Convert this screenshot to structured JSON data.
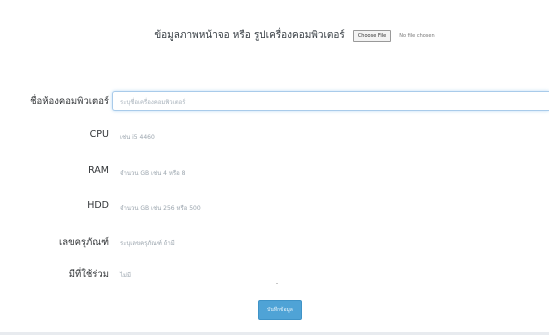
{
  "upload": {
    "label": "ข้อมูลภาพหน้าจอ หรือ รูปเครื่องคอมพิวเตอร์",
    "button_label": "Choose File",
    "status_text": "No file chosen"
  },
  "form": {
    "computer_name": {
      "label": "ชื่อห้องคอมพิวเตอร์",
      "placeholder": "ระบุชื่อเครื่องคอมพิวเตอร์"
    },
    "cpu": {
      "label": "CPU",
      "value": "เช่น i5 4460"
    },
    "ram": {
      "label": "RAM",
      "value": "จำนวน GB เช่น 4 หรือ 8"
    },
    "hdd": {
      "label": "HDD",
      "value": "จำนวน GB เช่น 256 หรือ 500"
    },
    "asset_number": {
      "label": "เลขครุภัณฑ์",
      "value": "ระบุเลขครุภัณฑ์ ถ้ามี"
    },
    "printer": {
      "label": "มีที่ใช้ร่วม",
      "value": "ไม่มี"
    }
  },
  "submit": {
    "label": "บันทึกข้อมูล"
  },
  "colors": {
    "primary": "#4fa3d6",
    "focus_border": "#a9cbea",
    "label_text": "#303336",
    "muted_text": "#9aa4ad"
  }
}
